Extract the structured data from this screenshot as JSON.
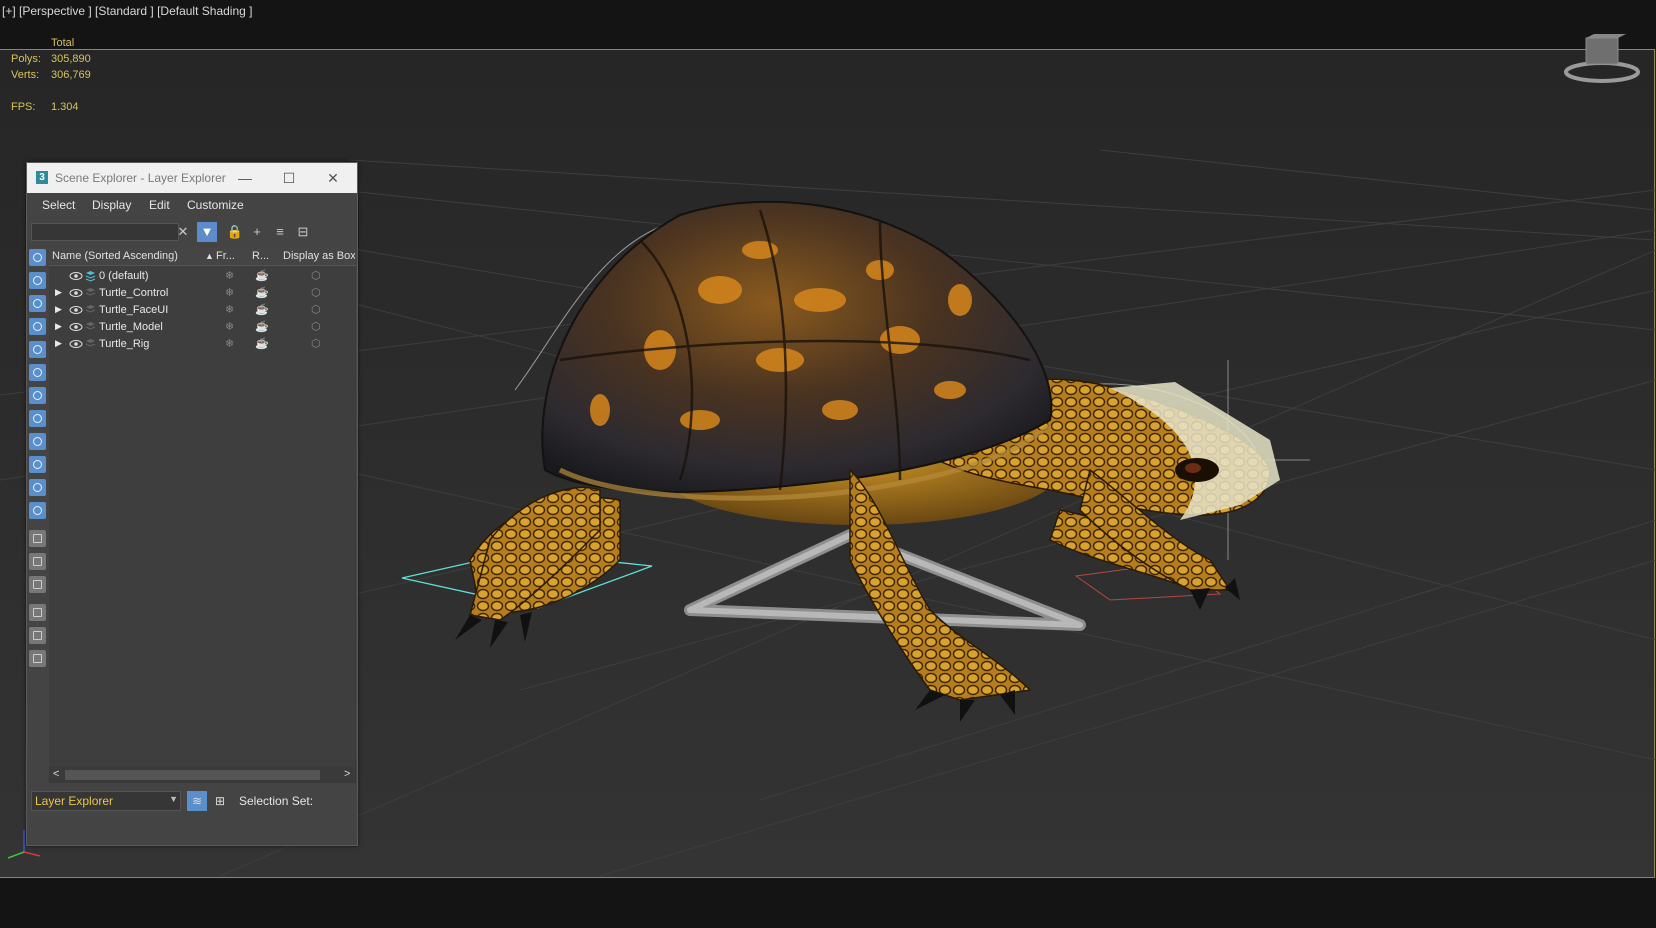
{
  "viewport": {
    "label": "[+] [Perspective ] [Standard ] [Default Shading ]",
    "stats": {
      "header": "Total",
      "polys_label": "Polys:",
      "polys_value": "305,890",
      "verts_label": "Verts:",
      "verts_value": "306,769",
      "fps_label": "FPS:",
      "fps_value": "1.304"
    }
  },
  "explorer": {
    "title": "Scene Explorer - Layer Explorer",
    "app_icon": "3",
    "window_buttons": {
      "minimize": "—",
      "maximize": "☐",
      "close": "✕"
    },
    "menu": [
      "Select",
      "Display",
      "Edit",
      "Customize"
    ],
    "search": {
      "value": "",
      "placeholder": ""
    },
    "columns": {
      "name": "Name (Sorted Ascending)",
      "sort_arrow": "▲",
      "freeze": "Fr...",
      "render": "R...",
      "display": "Display as Box"
    },
    "layers": [
      {
        "name": "0 (default)",
        "expandable": false
      },
      {
        "name": "Turtle_Control",
        "expandable": true
      },
      {
        "name": "Turtle_FaceUI",
        "expandable": true
      },
      {
        "name": "Turtle_Model",
        "expandable": true
      },
      {
        "name": "Turtle_Rig",
        "expandable": true
      }
    ],
    "footer": {
      "explorer_type": "Layer Explorer",
      "selection_set_label": "Selection Set:"
    }
  },
  "colors": {
    "accent": "#5b8fcb",
    "stats_text": "#d8c25a",
    "selection_box": "#5fe0d6",
    "frame_border": "#8f8a52"
  },
  "icons": [
    "eye-icon",
    "layer-icon",
    "snowflake-icon",
    "teapot-icon",
    "box-icon",
    "filter-icon",
    "lock-icon",
    "add-layer-icon",
    "viewcube-icon",
    "axis-tripod-icon"
  ]
}
